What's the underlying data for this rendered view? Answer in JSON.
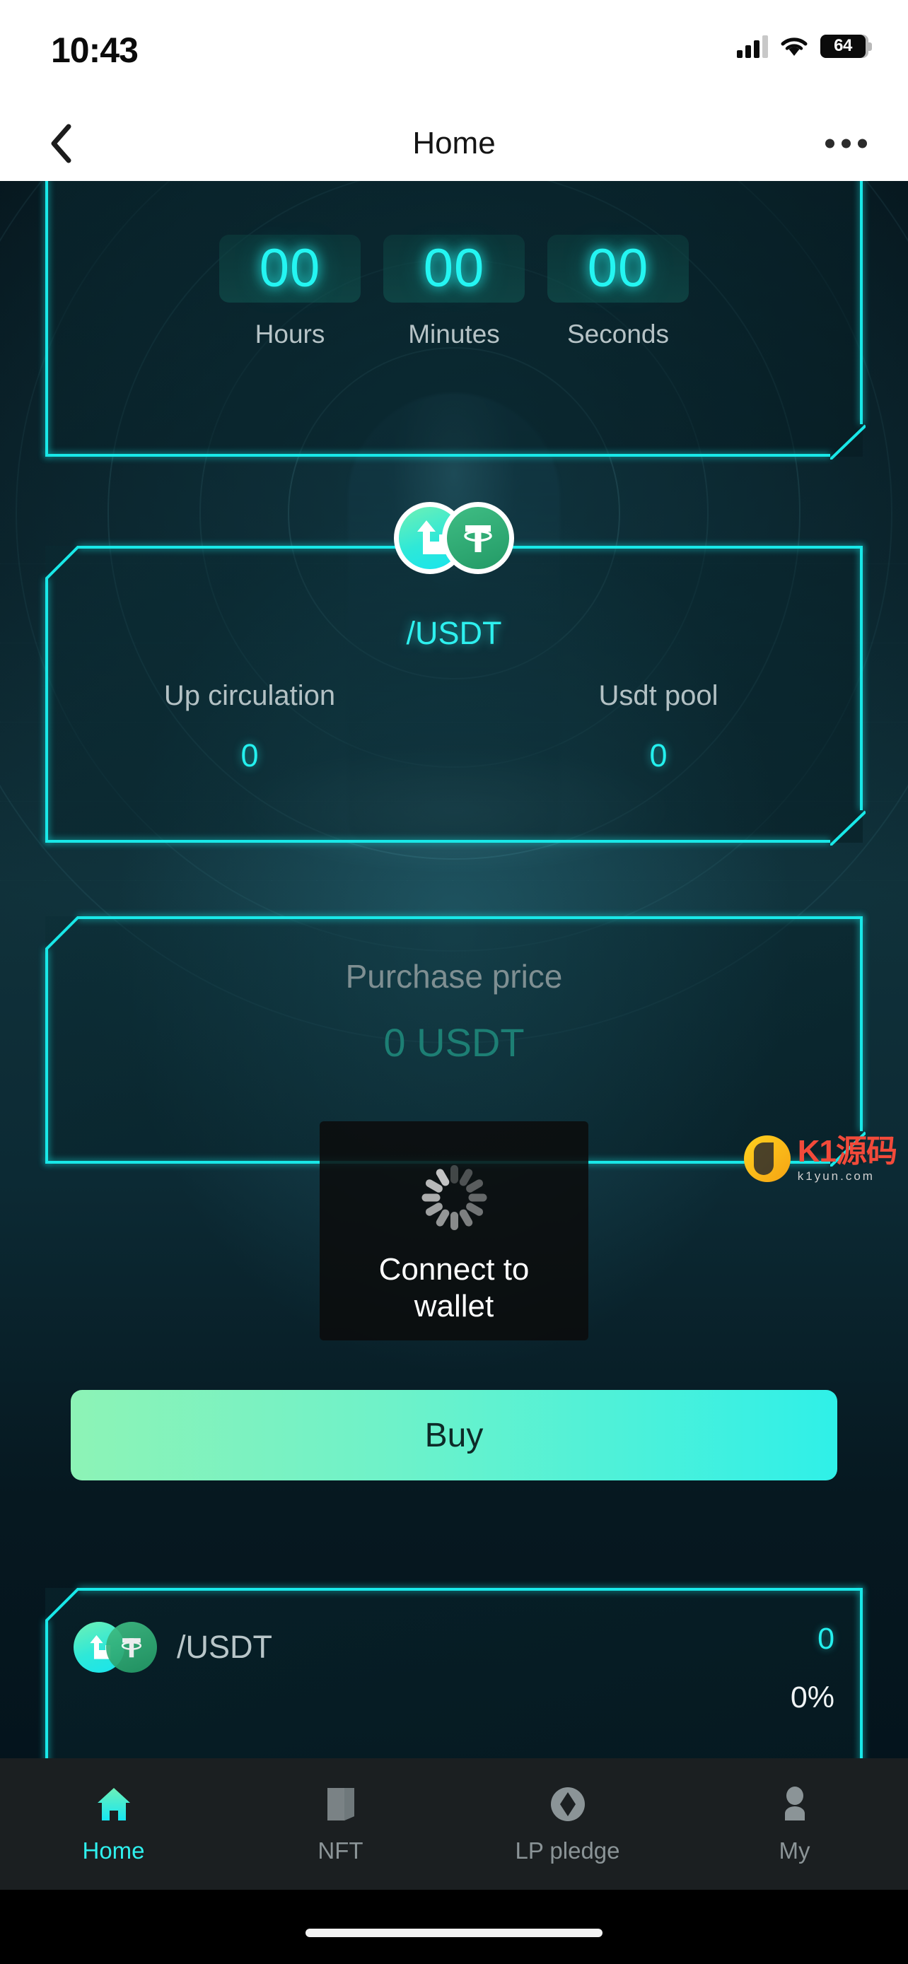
{
  "status_bar": {
    "time": "10:43",
    "battery_level": "64",
    "signal_icon": "cellular-signal-icon",
    "wifi_icon": "wifi-icon",
    "battery_icon": "battery-icon"
  },
  "nav_bar": {
    "back_icon": "back-chevron-icon",
    "title": "Home",
    "more_icon": "more-options-icon"
  },
  "countdown": {
    "units": [
      {
        "value": "00",
        "label": "Hours"
      },
      {
        "value": "00",
        "label": "Minutes"
      },
      {
        "value": "00",
        "label": "Seconds"
      }
    ]
  },
  "pool": {
    "pair_name": "/USDT",
    "up_icon": "up-token-icon",
    "usdt_icon": "usdt-token-icon",
    "stats": [
      {
        "label": "Up circulation",
        "value": "0"
      },
      {
        "label": "Usdt pool",
        "value": "0"
      }
    ]
  },
  "purchase": {
    "price_label": "Purchase price",
    "price_value": "0 USDT",
    "buy_label": "Buy"
  },
  "list": {
    "rows": [
      {
        "pair": "/USDT",
        "amount": "0",
        "percent": "0%",
        "up_icon": "up-token-icon",
        "usdt_icon": "usdt-token-icon"
      }
    ]
  },
  "toast": {
    "message": "Connect to wallet",
    "spinner_icon": "loading-spinner-icon"
  },
  "watermark": {
    "logo_icon": "k1-yuanma-logo-icon",
    "text": "K1源码",
    "subtext": "k1yun.com"
  },
  "tab_bar": {
    "items": [
      {
        "label": "Home",
        "icon": "home-icon",
        "active": true
      },
      {
        "label": "NFT",
        "icon": "nft-card-icon",
        "active": false
      },
      {
        "label": "LP pledge",
        "icon": "diamond-icon",
        "active": false
      },
      {
        "label": "My",
        "icon": "person-icon",
        "active": false
      }
    ]
  },
  "colors": {
    "accent_cyan": "#24f0ee",
    "border_neon": "#19e8e8",
    "buy_gradient_start": "#8df3b6",
    "buy_gradient_end": "#2ff0e8",
    "usdt_green": "#239a66",
    "muted_text": "#b3c1c4"
  }
}
